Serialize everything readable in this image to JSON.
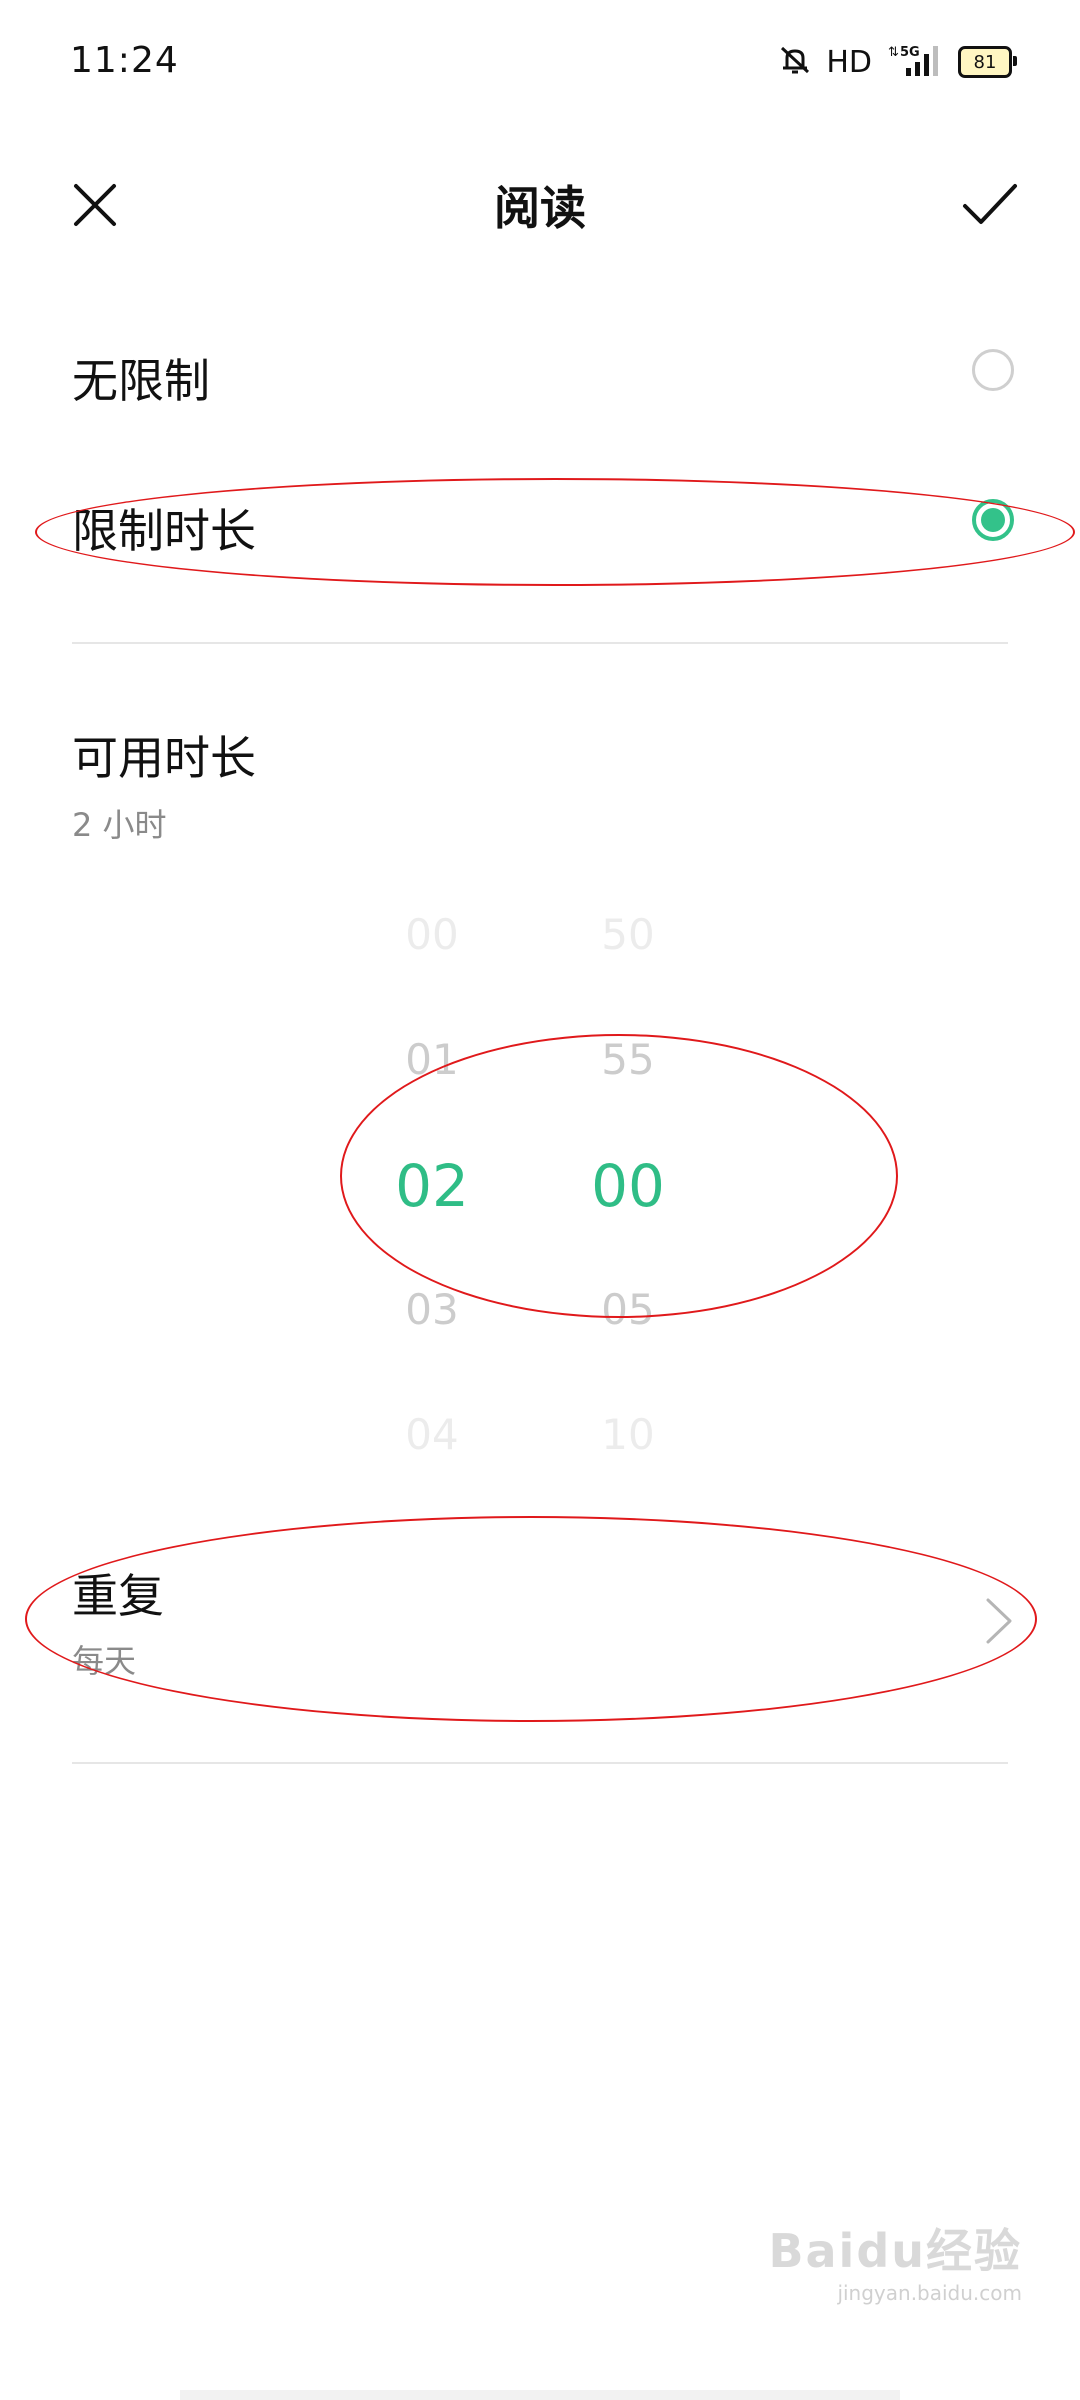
{
  "status_bar": {
    "time": "11:24",
    "hd": "HD",
    "network": "5G",
    "battery": "81"
  },
  "header": {
    "title": "阅读"
  },
  "limit_options": [
    {
      "label": "无限制",
      "selected": false
    },
    {
      "label": "限制时长",
      "selected": true
    }
  ],
  "available_time": {
    "title": "可用时长",
    "value": "2 小时"
  },
  "picker": {
    "hours": [
      "00",
      "01",
      "02",
      "03",
      "04"
    ],
    "minutes": [
      "50",
      "55",
      "00",
      "05",
      "10"
    ],
    "selected_hour": "02",
    "selected_minute": "00"
  },
  "repeat": {
    "title": "重复",
    "value": "每天"
  },
  "watermark": {
    "logo": "Baidu经验",
    "url": "jingyan.baidu.com"
  },
  "colors": {
    "accent": "#2fbd86",
    "annotation": "#e0191b"
  }
}
